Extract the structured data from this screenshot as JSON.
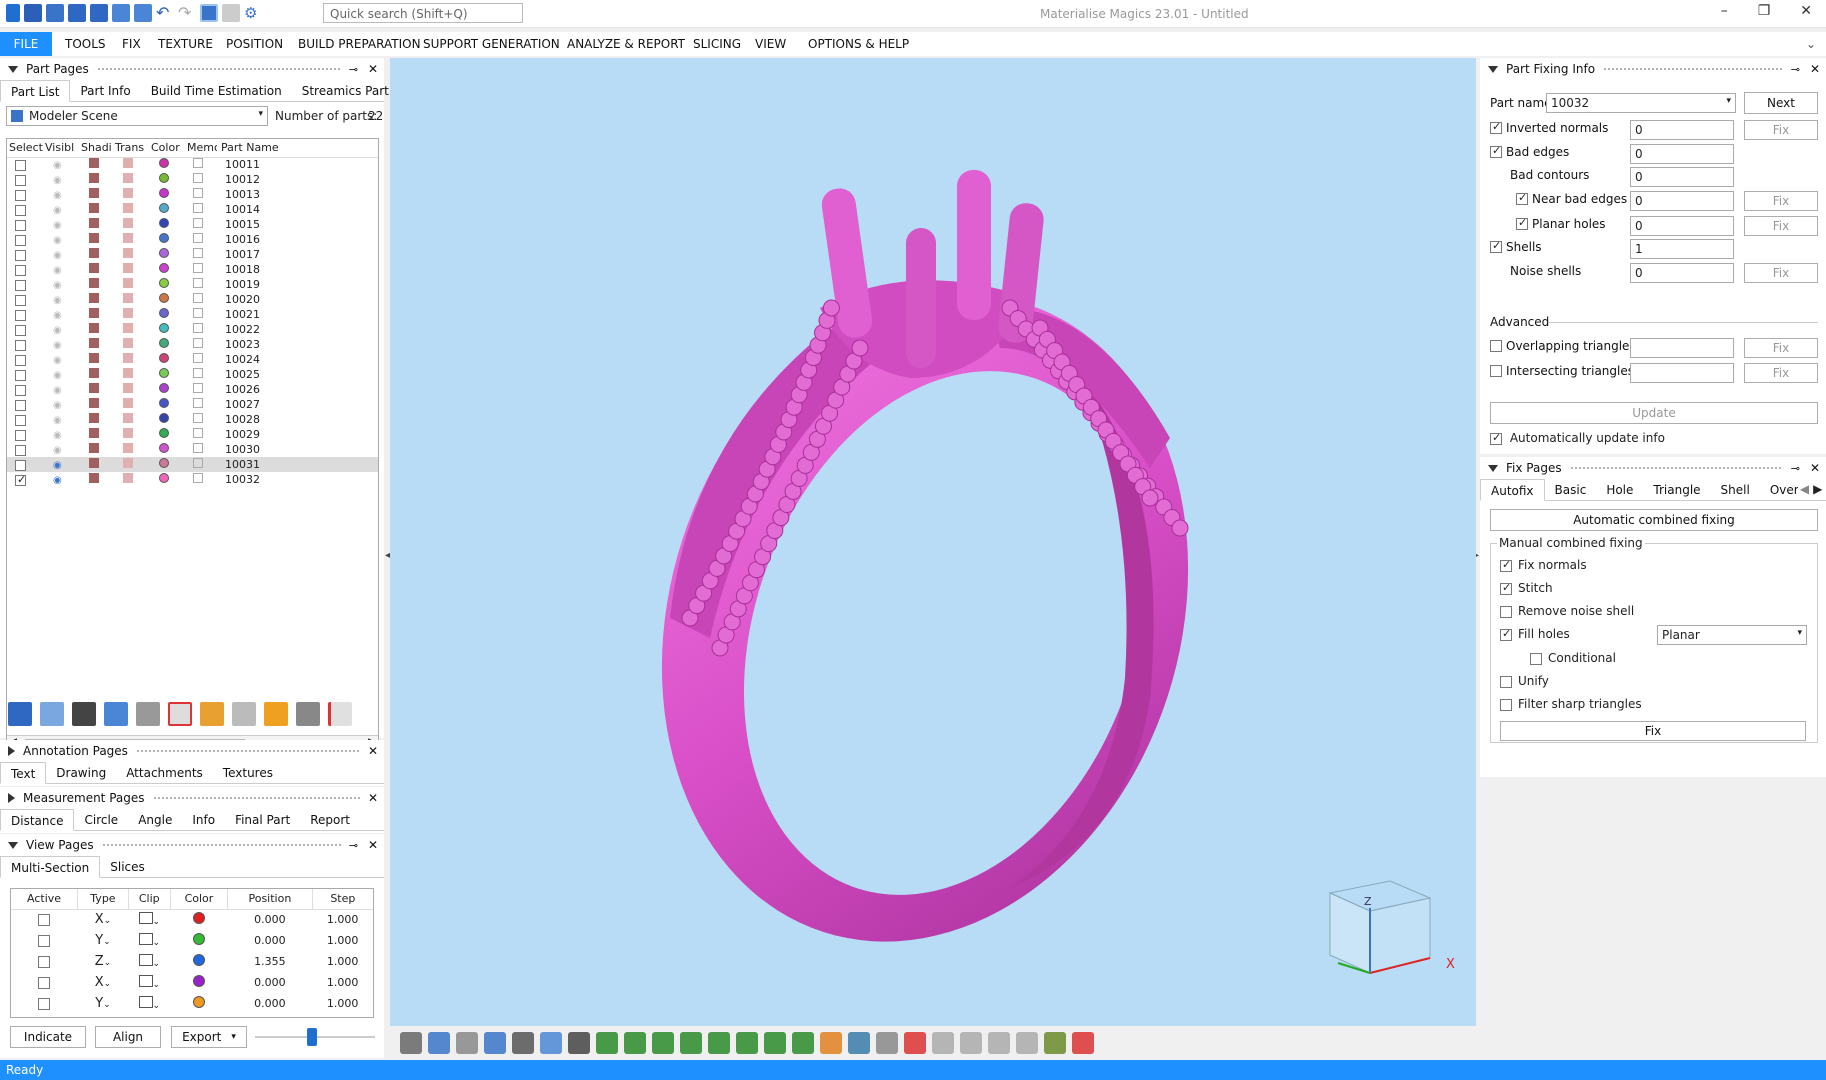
{
  "search": {
    "placeholder": "Quick search (Shift+Q)"
  },
  "app_title": "Materialise Magics 23.01 - Untitled",
  "menu": [
    "FILE",
    "TOOLS",
    "FIX",
    "TEXTURE",
    "POSITION",
    "BUILD PREPARATION",
    "SUPPORT GENERATION",
    "ANALYZE & REPORT",
    "SLICING",
    "VIEW",
    "OPTIONS & HELP"
  ],
  "part_pages": {
    "title": "Part Pages",
    "tabs": [
      "Part List",
      "Part Info",
      "Build Time Estimation",
      "Streamics Part"
    ],
    "scene": "Modeler Scene",
    "count_label": "Number of parts:",
    "count": "22",
    "columns": [
      "Select",
      "Visibl",
      "Shadi",
      "Trans",
      "Color",
      "Memo",
      "Part Name"
    ],
    "parts": [
      {
        "name": "10011",
        "color": "#cc33aa"
      },
      {
        "name": "10012",
        "color": "#77bb33"
      },
      {
        "name": "10013",
        "color": "#cc33cc"
      },
      {
        "name": "10014",
        "color": "#55aacc"
      },
      {
        "name": "10015",
        "color": "#3344bb"
      },
      {
        "name": "10016",
        "color": "#4477cc"
      },
      {
        "name": "10017",
        "color": "#aa66dd"
      },
      {
        "name": "10018",
        "color": "#cc44cc"
      },
      {
        "name": "10019",
        "color": "#88cc44"
      },
      {
        "name": "10020",
        "color": "#cc7744"
      },
      {
        "name": "10021",
        "color": "#6666cc"
      },
      {
        "name": "10022",
        "color": "#44bbbb"
      },
      {
        "name": "10023",
        "color": "#44aa77"
      },
      {
        "name": "10024",
        "color": "#cc4477"
      },
      {
        "name": "10025",
        "color": "#77cc55"
      },
      {
        "name": "10026",
        "color": "#aa44cc"
      },
      {
        "name": "10027",
        "color": "#4455cc"
      },
      {
        "name": "10028",
        "color": "#3344aa"
      },
      {
        "name": "10029",
        "color": "#33aa55"
      },
      {
        "name": "10030",
        "color": "#cc55cc"
      },
      {
        "name": "10031",
        "color": "#cc7799"
      },
      {
        "name": "10032",
        "color": "#ee66bb"
      }
    ]
  },
  "annotation_pages": {
    "title": "Annotation Pages",
    "tabs": [
      "Text",
      "Drawing",
      "Attachments",
      "Textures"
    ]
  },
  "measurement_pages": {
    "title": "Measurement Pages",
    "tabs": [
      "Distance",
      "Circle",
      "Angle",
      "Info",
      "Final Part",
      "Report"
    ]
  },
  "view_pages": {
    "title": "View Pages",
    "tabs": [
      "Multi-Section",
      "Slices"
    ],
    "columns": [
      "Active",
      "Type",
      "Clip",
      "Color",
      "Position",
      "Step"
    ],
    "rows": [
      {
        "type": "X",
        "color": "#e02020",
        "position": "0.000",
        "step": "1.000"
      },
      {
        "type": "Y",
        "color": "#33bb33",
        "position": "0.000",
        "step": "1.000"
      },
      {
        "type": "Z",
        "color": "#2266dd",
        "position": "1.355",
        "step": "1.000"
      },
      {
        "type": "X",
        "color": "#9922cc",
        "position": "0.000",
        "step": "1.000"
      },
      {
        "type": "Y",
        "color": "#ee9922",
        "position": "0.000",
        "step": "1.000"
      }
    ],
    "buttons": {
      "indicate": "Indicate",
      "align": "Align",
      "export": "Export"
    }
  },
  "fixing_info": {
    "title": "Part Fixing Info",
    "part_name_label": "Part name",
    "part_name": "10032",
    "next": "Next",
    "rows": [
      {
        "label": "Inverted normals",
        "value": "0",
        "checked": true,
        "fix": true,
        "indent": 0
      },
      {
        "label": "Bad edges",
        "value": "0",
        "checked": true,
        "fix": false,
        "indent": 0
      },
      {
        "label": "Bad contours",
        "value": "0",
        "checked": null,
        "fix": false,
        "indent": 1
      },
      {
        "label": "Near bad edges",
        "value": "0",
        "checked": true,
        "fix": true,
        "indent": 1
      },
      {
        "label": "Planar holes",
        "value": "0",
        "checked": true,
        "fix": true,
        "indent": 1
      },
      {
        "label": "Shells",
        "value": "1",
        "checked": true,
        "fix": false,
        "indent": 0
      },
      {
        "label": "Noise shells",
        "value": "0",
        "checked": null,
        "fix": true,
        "indent": 1
      }
    ],
    "advanced_label": "Advanced",
    "advanced": [
      {
        "label": "Overlapping triangles",
        "value": ""
      },
      {
        "label": "Intersecting triangles",
        "value": ""
      }
    ],
    "fix_label": "Fix",
    "update": "Update",
    "auto_update": "Automatically update info"
  },
  "fix_pages": {
    "title": "Fix Pages",
    "tabs": [
      "Autofix",
      "Basic",
      "Hole",
      "Triangle",
      "Shell",
      "Overla"
    ],
    "auto_combined": "Automatic combined fixing",
    "manual_label": "Manual combined fixing",
    "options": [
      {
        "label": "Fix normals",
        "checked": true
      },
      {
        "label": "Stitch",
        "checked": true
      },
      {
        "label": "Remove noise shell",
        "checked": false
      },
      {
        "label": "Fill holes",
        "checked": true
      },
      {
        "label": "Conditional",
        "checked": false
      },
      {
        "label": "Unify",
        "checked": false
      },
      {
        "label": "Filter sharp triangles",
        "checked": false
      }
    ],
    "fill_mode": "Planar",
    "fix": "Fix"
  },
  "axes": {
    "z": "Z",
    "x": "X"
  },
  "status": "Ready",
  "colors": {
    "accent": "#1e90ff",
    "viewport": "#b8dcf5",
    "ring": "#d94fc8"
  }
}
